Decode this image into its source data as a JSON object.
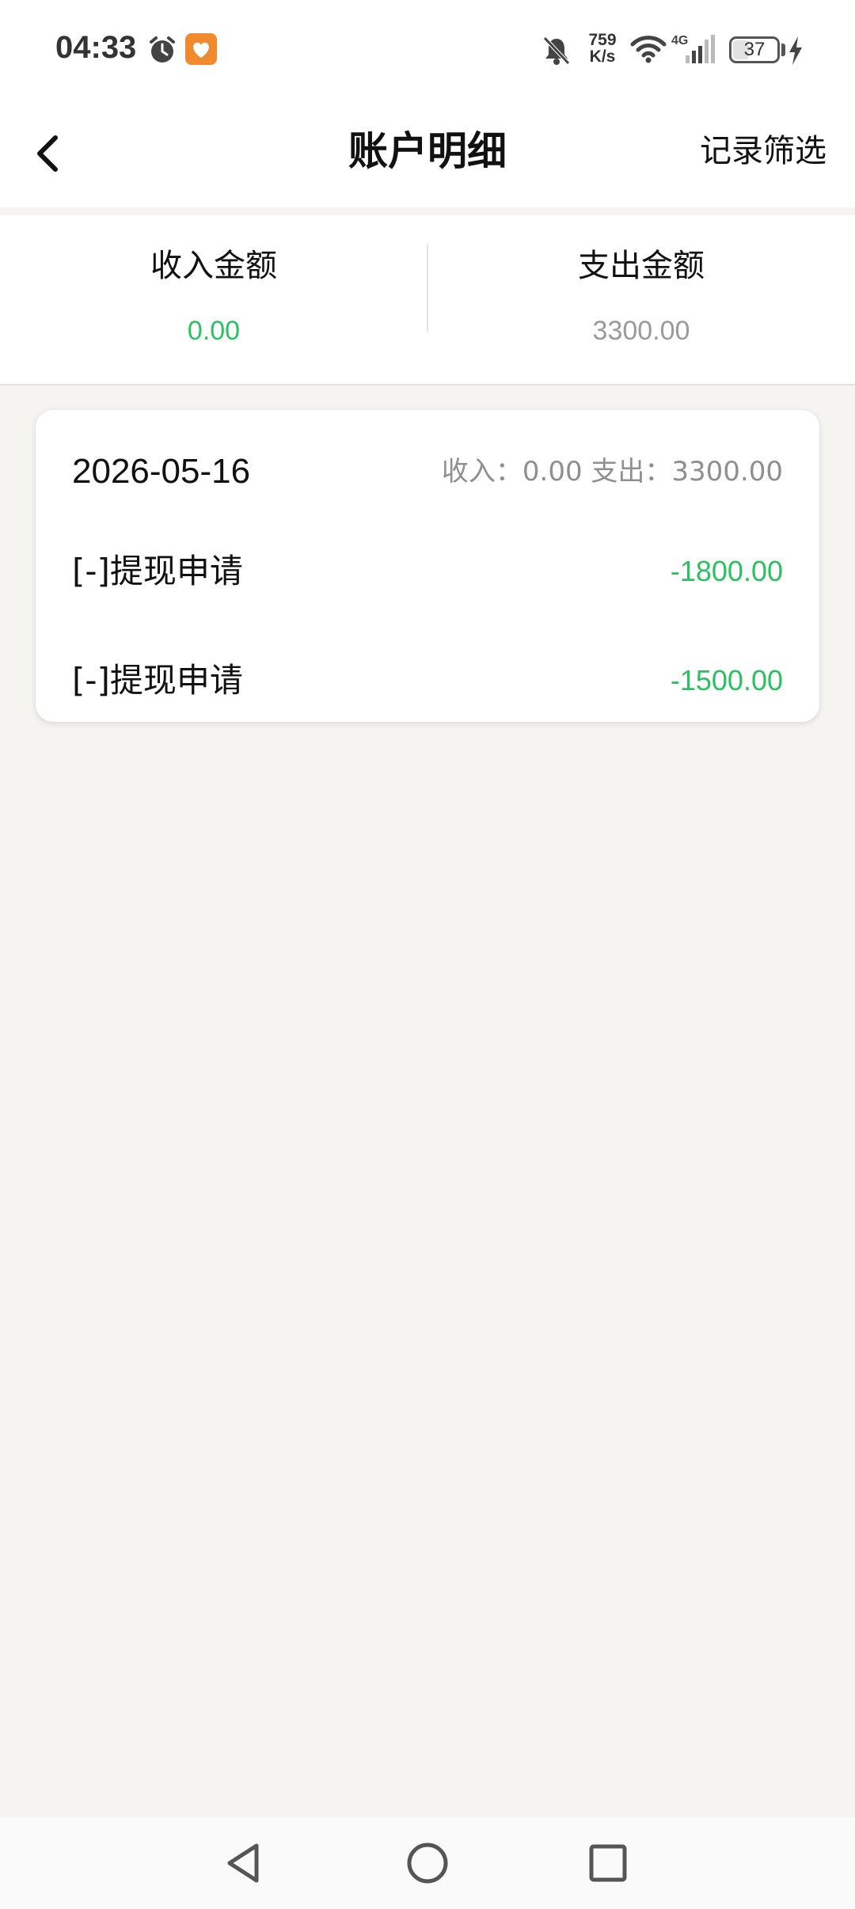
{
  "status_bar": {
    "time": "04:33",
    "net_speed_value": "759",
    "net_speed_unit": "K/s",
    "network_type": "4G",
    "battery_level": "37",
    "icons": [
      "alarm-icon",
      "app-notification-icon",
      "bell-muted-icon",
      "wifi-icon",
      "signal-icon",
      "battery-icon",
      "charging-bolt-icon"
    ]
  },
  "header": {
    "title": "账户明细",
    "filter_label": "记录筛选",
    "back_icon": "chevron-left-icon"
  },
  "summary": {
    "income_label": "收入金额",
    "income_value": "0.00",
    "expense_label": "支出金额",
    "expense_value": "3300.00"
  },
  "records": {
    "date": "2026-05-16",
    "totals_text": "收入：0.00 支出：3300.00",
    "items": [
      {
        "title": "[-]提现申请",
        "amount": "-1800.00"
      },
      {
        "title": "[-]提现申请",
        "amount": "-1500.00"
      }
    ]
  },
  "bottom_nav": {
    "icons": [
      "nav-back-icon",
      "nav-home-icon",
      "nav-recents-icon"
    ]
  },
  "colors": {
    "income_green": "#2ec060",
    "expense_gray": "#9a9a9a",
    "background": "#f5f4f0"
  }
}
